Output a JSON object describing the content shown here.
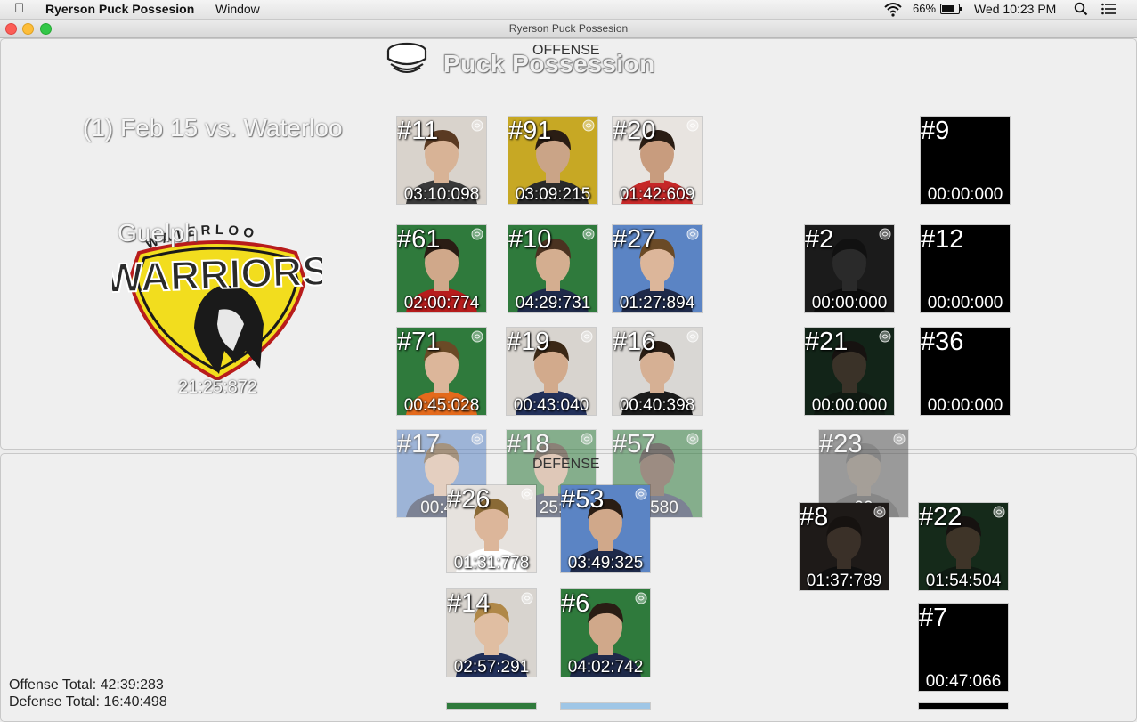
{
  "menubar": {
    "app_name": "Ryerson Puck Possesion",
    "menu_window": "Window",
    "battery": "66%",
    "clock": "Wed 10:23 PM"
  },
  "window": {
    "title": "Ryerson Puck Possesion"
  },
  "header": {
    "offense_label": "OFFENSE",
    "title": "Puck Possession"
  },
  "game": {
    "label": "(1) Feb 15 vs. Waterloo",
    "opponent": "Guelph",
    "total_time": "21:25:872"
  },
  "defense_label": "DEFENSE",
  "totals": {
    "offense": "Offense Total: 42:39:283",
    "defense": "Defense Total: 16:40:498"
  },
  "players": [
    {
      "number": "#11",
      "time": "03:10:098",
      "bg": "#d9d3cc",
      "jersey": "#3a3a3a",
      "skin": "#d8b396",
      "hair": "#5a3a22"
    },
    {
      "number": "#91",
      "time": "03:09:215",
      "bg": "#c7a824",
      "jersey": "#2a2a2a",
      "skin": "#caa487",
      "hair": "#2a1d14"
    },
    {
      "number": "#20",
      "time": "01:42:609",
      "bg": "#e8e4e0",
      "jersey": "#c62828",
      "skin": "#c89c7e",
      "hair": "#2a1d14"
    },
    {
      "number": "#9",
      "time": "00:00:000",
      "bg": "#000000",
      "jersey": "#000000",
      "skin": "#000000",
      "hair": "#000000"
    },
    {
      "number": "#61",
      "time": "02:00:774",
      "bg": "#2f7a3c",
      "jersey": "#b71c1c",
      "skin": "#d0a88a",
      "hair": "#2a1d14"
    },
    {
      "number": "#10",
      "time": "04:29:731",
      "bg": "#2f7a3c",
      "jersey": "#1f2a4a",
      "skin": "#d4ae90",
      "hair": "#4a3220"
    },
    {
      "number": "#27",
      "time": "01:27:894",
      "bg": "#5b84c4",
      "jersey": "#1f2a4a",
      "skin": "#dcb69a",
      "hair": "#6a4a26"
    },
    {
      "number": "#2",
      "time": "00:00:000",
      "bg": "#1b1b1b",
      "jersey": "#0c0c0c",
      "skin": "#2a2a2a",
      "hair": "#111111"
    },
    {
      "number": "#12",
      "time": "00:00:000",
      "bg": "#000000",
      "jersey": "#000000",
      "skin": "#000000",
      "hair": "#000000"
    },
    {
      "number": "#71",
      "time": "00:45:028",
      "bg": "#2f7a3c",
      "jersey": "#e46a1c",
      "skin": "#dcb69a",
      "hair": "#6a4a26"
    },
    {
      "number": "#19",
      "time": "00:43:040",
      "bg": "#d8d4cf",
      "jersey": "#22305a",
      "skin": "#d2aa8c",
      "hair": "#3b2816"
    },
    {
      "number": "#16",
      "time": "00:40:398",
      "bg": "#d9d7d4",
      "jersey": "#1b1b1b",
      "skin": "#d6b094",
      "hair": "#2a1d14"
    },
    {
      "number": "#21",
      "time": "00:00:000",
      "bg": "#122418",
      "jersey": "#0f1a12",
      "skin": "#3a3228",
      "hair": "#161210"
    },
    {
      "number": "#36",
      "time": "00:00:000",
      "bg": "#000000",
      "jersey": "#000000",
      "skin": "#000000",
      "hair": "#000000"
    },
    {
      "number": "#17",
      "time": "00:43",
      "bg": "#5b84c4",
      "jersey": "#1f2a4a",
      "skin": "#dcb69a",
      "hair": "#6a4a26"
    },
    {
      "number": "#18",
      "time": "25:",
      "bg": "#2f7a3c",
      "jersey": "#1f2a4a",
      "skin": "#d2aa8c",
      "hair": "#3b2816"
    },
    {
      "number": "#57",
      "time": "5:580",
      "bg": "#2f7a3c",
      "jersey": "#1f2a4a",
      "skin": "#5a3c2a",
      "hair": "#1a120c"
    },
    {
      "number": "#23",
      "time": "00",
      "bg": "#555555",
      "jersey": "#333333",
      "skin": "#6a5e52",
      "hair": "#333333"
    },
    {
      "number": "#26",
      "time": "01:31:778",
      "bg": "#e6e2de",
      "jersey": "#ffffff",
      "skin": "#dcb69a",
      "hair": "#8a6a36"
    },
    {
      "number": "#53",
      "time": "03:49:325",
      "bg": "#5b84c4",
      "jersey": "#1f2a4a",
      "skin": "#d0a88a",
      "hair": "#2a1d14"
    },
    {
      "number": "#8",
      "time": "01:37:789",
      "bg": "#1e1a18",
      "jersey": "#0f0f0f",
      "skin": "#3a3028",
      "hair": "#161210"
    },
    {
      "number": "#22",
      "time": "01:54:504",
      "bg": "#152a1a",
      "jersey": "#0f1a12",
      "skin": "#3e3428",
      "hair": "#161210"
    },
    {
      "number": "#14",
      "time": "02:57:291",
      "bg": "#d8d4cf",
      "jersey": "#22305a",
      "skin": "#e0bea2",
      "hair": "#b08848"
    },
    {
      "number": "#6",
      "time": "04:02:742",
      "bg": "#2f7a3c",
      "jersey": "#1f2a4a",
      "skin": "#d0a88a",
      "hair": "#2a1d14"
    },
    {
      "number": "#7",
      "time": "00:47:066",
      "bg": "#000000",
      "jersey": "#000000",
      "skin": "#000000",
      "hair": "#000000"
    }
  ]
}
